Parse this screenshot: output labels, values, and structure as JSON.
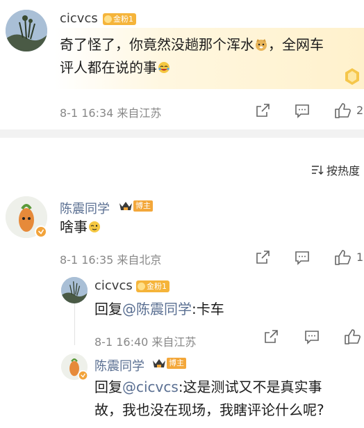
{
  "post": {
    "username": "cicvcs",
    "fan_badge": "金粉1",
    "text_line1": "奇了怪了，你竟然没趟那个浑水",
    "text_line1_end": "，全网车",
    "text_line2": "评人都在说的事",
    "meta": "8-1 16:34 来自江苏",
    "like_count": "2"
  },
  "sort": {
    "label": "按热度"
  },
  "comments": [
    {
      "username": "陈震同学",
      "badge": "博主",
      "text": "啥事",
      "meta": "8-1 16:35 来自北京",
      "like_count": "1"
    }
  ],
  "replies": [
    {
      "username": "cicvcs",
      "fan_badge": "金粉1",
      "prefix": "回复",
      "mention": "@陈震同学",
      "text": ":卡车",
      "meta": "8-1 16:40 来自江苏"
    },
    {
      "username": "陈震同学",
      "badge": "博主",
      "prefix": "回复",
      "mention": "@cicvcs",
      "text_line1": ":这是测试又不是真实事",
      "text_line2": "故，我也没在现场，我瞎评论什么呢?"
    }
  ],
  "icons": {
    "share": "share-icon",
    "comment": "comment-icon",
    "like": "like-icon",
    "sort": "sort-icon"
  },
  "colors": {
    "badge": "#f5b43a",
    "link": "#5a6f92",
    "meta": "#888888"
  }
}
